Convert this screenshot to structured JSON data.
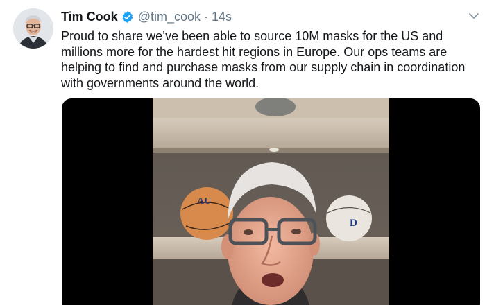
{
  "tweet": {
    "display_name": "Tim Cook",
    "handle": "@tim_cook",
    "separator": "·",
    "timestamp": "14s",
    "text": "Proud to share we’ve been able to source 10M masks for the US and millions more for the hardest hit regions in Europe. Our ops teams are helping to find and purchase masks from our supply chain in coordination with governments around the world."
  },
  "icons": {
    "verified": "verified-badge-icon",
    "caret": "chevron-down-icon"
  },
  "colors": {
    "verified_blue": "#1da1f2",
    "secondary_text": "#657786",
    "primary_text": "#14171a"
  }
}
